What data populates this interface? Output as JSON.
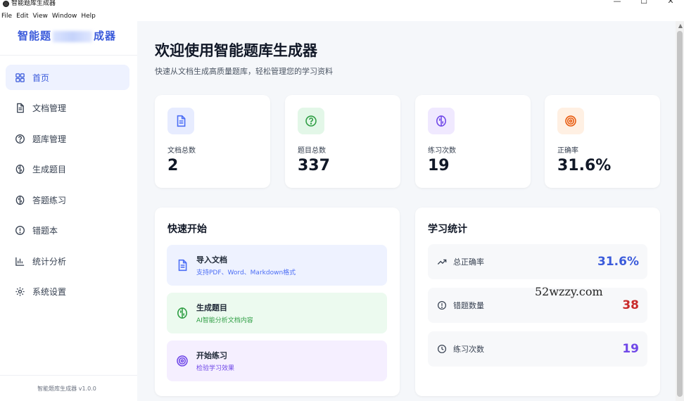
{
  "window": {
    "title": "智能题库生成器",
    "controls": [
      "—",
      "☐",
      "✕"
    ]
  },
  "menubar": [
    "File",
    "Edit",
    "View",
    "Window",
    "Help"
  ],
  "sidebar": {
    "brand_left": "智能题",
    "brand_right": "成器",
    "items": [
      {
        "label": "首页",
        "icon": "grid-icon",
        "active": true
      },
      {
        "label": "文档管理",
        "icon": "document-icon"
      },
      {
        "label": "题库管理",
        "icon": "question-circle-icon"
      },
      {
        "label": "生成题目",
        "icon": "brain-icon"
      },
      {
        "label": "答题练习",
        "icon": "brain-icon"
      },
      {
        "label": "错题本",
        "icon": "alert-circle-icon"
      },
      {
        "label": "统计分析",
        "icon": "bar-chart-icon"
      },
      {
        "label": "系统设置",
        "icon": "gear-icon"
      }
    ],
    "version": "智能题库生成器 v1.0.0"
  },
  "header": {
    "title": "欢迎使用智能题库生成器",
    "subtitle": "快速从文档生成高质量题库，轻松管理您的学习资料"
  },
  "stats": [
    {
      "label": "文档总数",
      "value": "2",
      "icon": "document-icon",
      "color": "#4c6ef5",
      "bg": "#e7ecff"
    },
    {
      "label": "题目总数",
      "value": "337",
      "icon": "question-circle-icon",
      "color": "#2f9e44",
      "bg": "#e3f7e8"
    },
    {
      "label": "练习次数",
      "value": "19",
      "icon": "brain-icon",
      "color": "#7048e8",
      "bg": "#f0e9ff"
    },
    {
      "label": "正确率",
      "value": "31.6%",
      "icon": "target-icon",
      "color": "#e8590c",
      "bg": "#fff0e3"
    }
  ],
  "quick_start": {
    "title": "快速开始",
    "items": [
      {
        "title": "导入文档",
        "desc": "支持PDF、Word、Markdown格式",
        "icon": "document-icon",
        "color": "#4c6ef5",
        "bg": "#eef2ff",
        "desc_color": "#4c6ef5"
      },
      {
        "title": "生成题目",
        "desc": "AI智能分析文档内容",
        "icon": "brain-icon",
        "color": "#2f9e44",
        "bg": "#ecfaef",
        "desc_color": "#2f9e44"
      },
      {
        "title": "开始练习",
        "desc": "检验学习效果",
        "icon": "target-icon",
        "color": "#7048e8",
        "bg": "#f5efff",
        "desc_color": "#7048e8"
      }
    ]
  },
  "learning_stats": {
    "title": "学习统计",
    "rows": [
      {
        "label": "总正确率",
        "value": "31.6%",
        "icon": "trending-up-icon",
        "color": "#3b5bdb"
      },
      {
        "label": "错题数量",
        "value": "38",
        "icon": "alert-circle-icon",
        "color": "#c92a2a"
      },
      {
        "label": "练习次数",
        "value": "19",
        "icon": "clock-icon",
        "color": "#7048e8"
      }
    ]
  },
  "watermark": "52wzzy.com"
}
